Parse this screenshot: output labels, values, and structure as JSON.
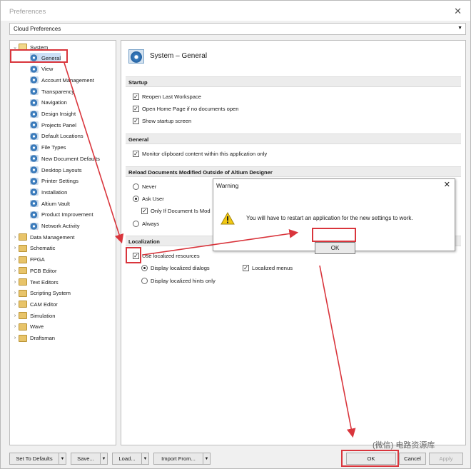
{
  "window": {
    "title": "Preferences"
  },
  "cloud_select": {
    "value": "Cloud Preferences",
    "arrow_icon": "chevron-down-icon"
  },
  "tree": {
    "system_label": "System",
    "system_children": [
      "General",
      "View",
      "Account Management",
      "Transparency",
      "Navigation",
      "Design Insight",
      "Projects Panel",
      "Default Locations",
      "File Types",
      "New Document Defaults",
      "Desktop Layouts",
      "Printer Settings",
      "Installation",
      "Altium Vault",
      "Product Improvement",
      "Network Activity"
    ],
    "folders": [
      "Data Management",
      "Schematic",
      "FPGA",
      "PCB Editor",
      "Text Editors",
      "Scripting System",
      "CAM Editor",
      "Simulation",
      "Wave",
      "Draftsman"
    ]
  },
  "panel": {
    "title": "System – General",
    "startup": {
      "heading": "Startup",
      "options": [
        "Reopen Last Workspace",
        "Open Home Page if no documents open",
        "Show startup screen"
      ]
    },
    "general": {
      "heading": "General",
      "option": "Monitor clipboard content within this application only"
    },
    "reload": {
      "heading": "Reload Documents Modified Outside of Altium Designer",
      "never": "Never",
      "ask": "Ask User",
      "only_if": "Only If Document Is Mod",
      "always": "Always"
    },
    "localization": {
      "heading": "Localization",
      "use_localized": "Use localized resources",
      "display_dialogs": "Display localized dialogs",
      "localized_menus": "Localized menus",
      "display_hints": "Display localized hints only"
    }
  },
  "warning": {
    "title": "Warning",
    "message": "You will have to restart an application for the new settings to work.",
    "ok": "OK"
  },
  "footer": {
    "set_defaults": "Set To Defaults",
    "save": "Save...",
    "load": "Load...",
    "import": "Import From...",
    "ok": "OK",
    "cancel": "Cancel",
    "apply": "Apply"
  },
  "watermark": "(微信) 电路资源库",
  "colors": {
    "highlight": "#d9353c",
    "selection": "#cce0f7"
  }
}
